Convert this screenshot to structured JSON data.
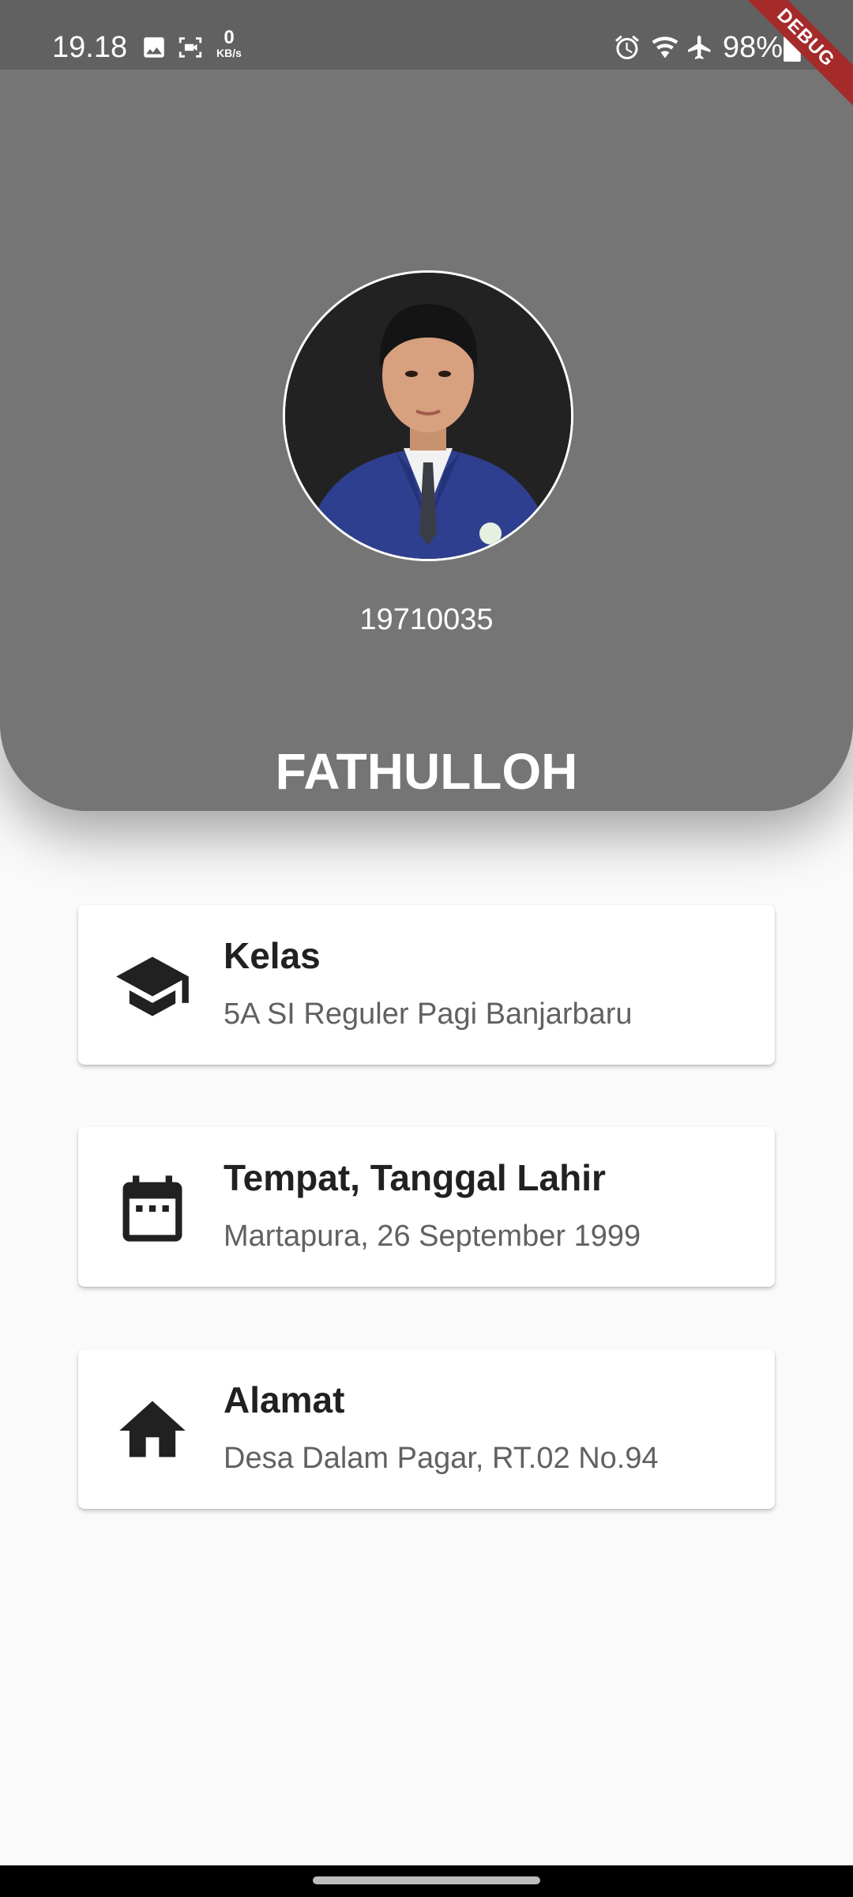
{
  "status_bar": {
    "time": "19.18",
    "speed_value": "0",
    "speed_unit": "KB/s",
    "battery": "98%"
  },
  "debug_banner": "DEBUG",
  "profile": {
    "student_id": "19710035",
    "name": "FATHULLOH"
  },
  "cards": [
    {
      "icon": "graduation-cap-icon",
      "title": "Kelas",
      "value": "5A SI Reguler Pagi Banjarbaru"
    },
    {
      "icon": "calendar-icon",
      "title": "Tempat, Tanggal Lahir",
      "value": "Martapura, 26 September 1999"
    },
    {
      "icon": "home-icon",
      "title": "Alamat",
      "value": "Desa Dalam Pagar, RT.02 No.94"
    }
  ],
  "colors": {
    "header_bg": "#757575",
    "status_bg": "#616161",
    "page_bg": "#fafafa",
    "card_bg": "#ffffff",
    "debug_banner": "#a52a2a"
  }
}
